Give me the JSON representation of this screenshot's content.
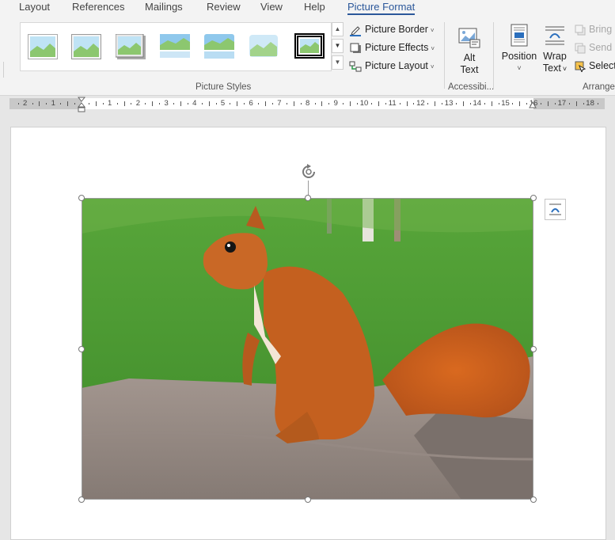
{
  "tabs": [
    {
      "label": "Layout"
    },
    {
      "label": "References"
    },
    {
      "label": "Mailings"
    },
    {
      "label": "Review"
    },
    {
      "label": "View"
    },
    {
      "label": "Help"
    },
    {
      "label": "Picture Format",
      "active": true
    }
  ],
  "ribbon": {
    "picture_styles": {
      "group_label": "Picture Styles",
      "thumbnails": [
        "simple-frame",
        "soft-edge-frame",
        "shadow-frame",
        "reflected",
        "reflected-rounded",
        "soft-edge",
        "thick-black-frame"
      ],
      "commands": [
        {
          "label": "Picture Border",
          "icon": "pencil-border-icon"
        },
        {
          "label": "Picture Effects",
          "icon": "effects-icon"
        },
        {
          "label": "Picture Layout",
          "icon": "picture-layout-icon"
        }
      ]
    },
    "accessibility": {
      "group_label": "Accessibi...",
      "alt_text": {
        "line1": "Alt",
        "line2": "Text"
      }
    },
    "arrange": {
      "group_label": "Arrange",
      "position": {
        "label": "Position",
        "chevron": "˅"
      },
      "wrap_text": {
        "line1": "Wrap",
        "line2": "Text",
        "chevron": "˅"
      },
      "bring_forward": "Bring F",
      "send_backward": "Send B",
      "selection_pane": "Selectio"
    }
  },
  "ruler": {
    "labels": [
      "2",
      "1",
      "1",
      "2",
      "3",
      "4",
      "5",
      "6",
      "7",
      "8",
      "9",
      "10",
      "11",
      "12",
      "13",
      "14",
      "15",
      "16",
      "17",
      "18"
    ]
  },
  "colors": {
    "accent": "#2b579a",
    "ribbon_bg": "#f3f3f3",
    "canvas_bg": "#e6e6e6"
  }
}
